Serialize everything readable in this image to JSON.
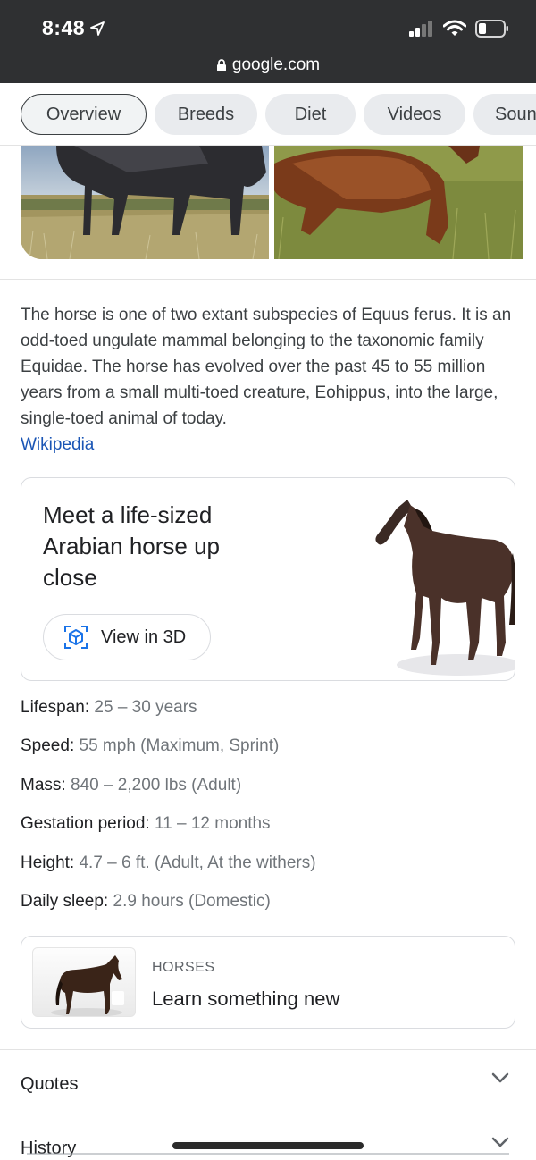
{
  "status_bar": {
    "time": "8:48",
    "url": "google.com"
  },
  "tabs": [
    {
      "label": "Overview",
      "active": true
    },
    {
      "label": "Breeds"
    },
    {
      "label": "Diet"
    },
    {
      "label": "Videos"
    },
    {
      "label": "Soun"
    }
  ],
  "description": {
    "text": "The horse is one of two extant subspecies of Equus ferus. It is an odd-toed ungulate mammal belonging to the taxonomic family Equidae. The horse has evolved over the past 45 to 55 million years from a small multi-toed creature, Eohippus, into the large, single-toed animal of today.",
    "source": "Wikipedia"
  },
  "card_3d": {
    "title": "Meet a life-sized Arabian horse up close",
    "button": "View in 3D"
  },
  "facts": [
    {
      "label": "Lifespan:",
      "value": "25 – 30 years"
    },
    {
      "label": "Speed:",
      "value": "55 mph (Maximum, Sprint)"
    },
    {
      "label": "Mass:",
      "value": "840 – 2,200 lbs (Adult)"
    },
    {
      "label": "Gestation period:",
      "value": "11 – 12 months"
    },
    {
      "label": "Height:",
      "value": "4.7 – 6 ft. (Adult, At the withers)"
    },
    {
      "label": "Daily sleep:",
      "value": "2.9 hours (Domestic)"
    }
  ],
  "learn_card": {
    "kicker": "HORSES",
    "title": "Learn something new"
  },
  "accordion": [
    {
      "label": "Quotes"
    },
    {
      "label": "History"
    }
  ],
  "colors": {
    "status_bar_bg": "#2f3032",
    "link": "#1a55b5",
    "tab_bg": "#e9ebee",
    "fact_value": "#70757a"
  }
}
